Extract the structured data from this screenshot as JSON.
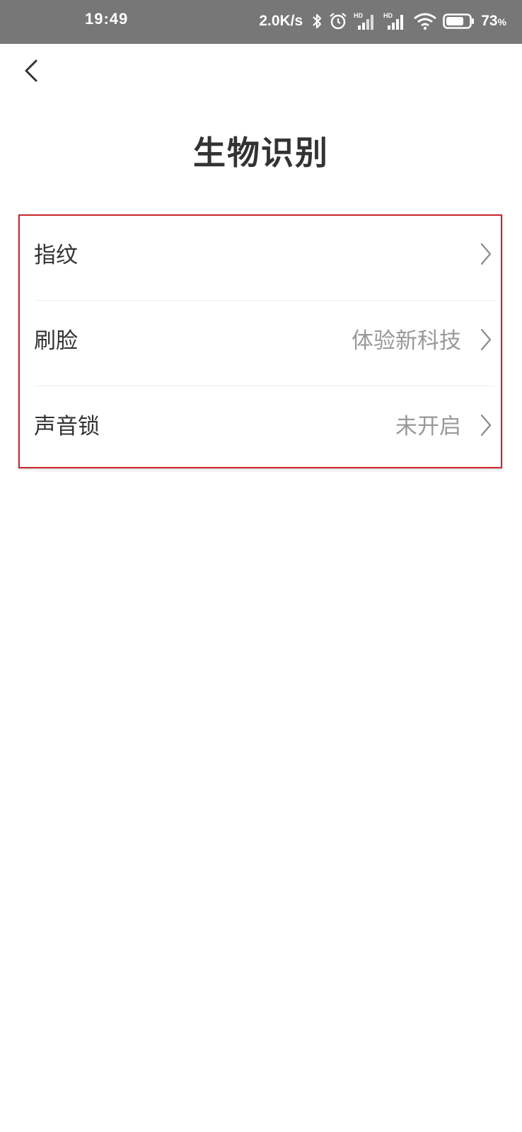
{
  "status_bar": {
    "time": "19:49",
    "net_speed": "2.0K/s",
    "signal_1_label": "HD",
    "signal_2_label": "HD",
    "battery_level": "73",
    "battery_unit": "%",
    "icons": [
      "bluetooth-icon",
      "alarm-icon",
      "signal-icon",
      "signal-icon",
      "wifi-icon",
      "battery-icon"
    ]
  },
  "header": {
    "title": "生物识别",
    "back_icon": "chevron-left-icon"
  },
  "items": [
    {
      "label": "指纹",
      "value": ""
    },
    {
      "label": "刷脸",
      "value": "体验新科技"
    },
    {
      "label": "声音锁",
      "value": "未开启"
    }
  ],
  "colors": {
    "highlight_border": "#c9282d",
    "secondary_text": "#999999",
    "status_bar_bg": "#777777"
  }
}
